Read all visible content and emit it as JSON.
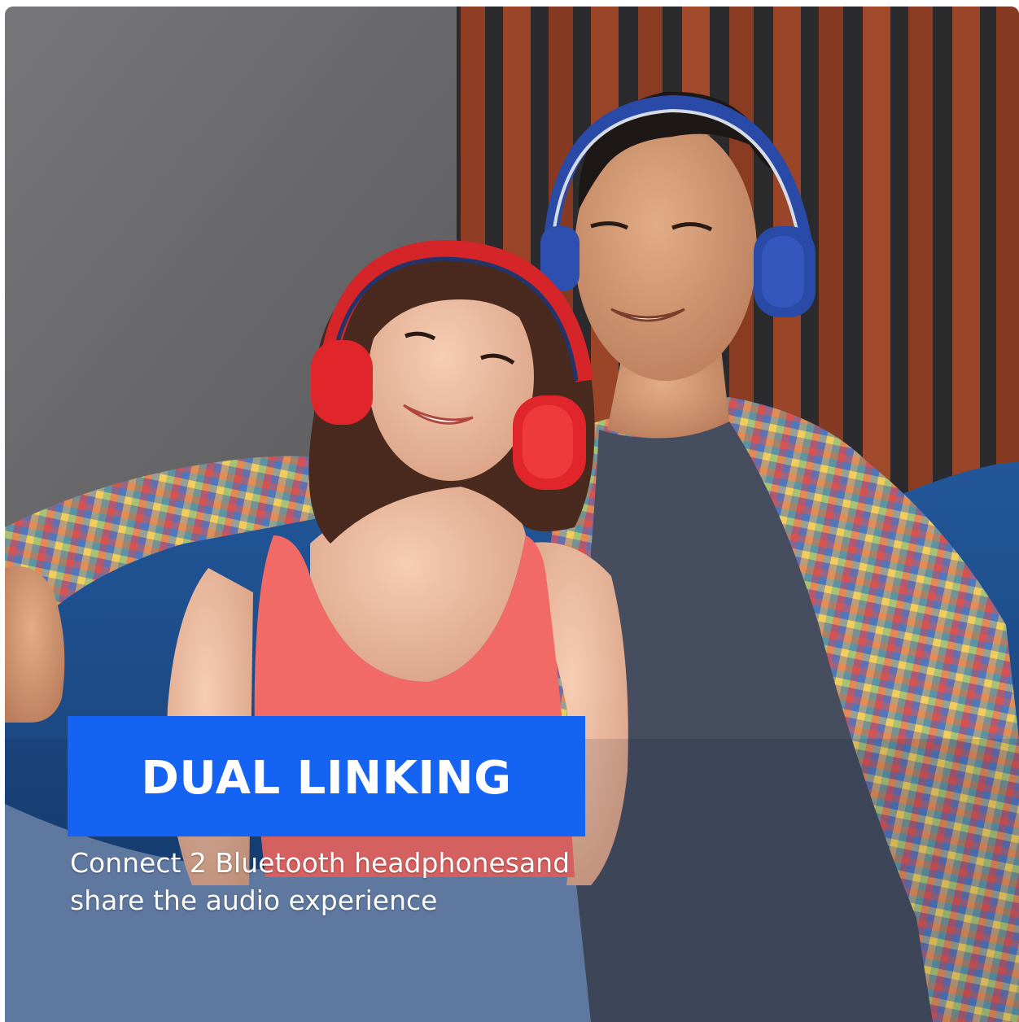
{
  "banner": {
    "title": "DUAL LINKING"
  },
  "caption": {
    "line1": "Connect 2 Bluetooth headphonesand",
    "line2": "share the audio experience"
  },
  "colors": {
    "banner": "#1463f2",
    "text": "#ffffff",
    "wall": "#6f6f71",
    "wood": "#8a3a22",
    "sofa": "#1f4f8e",
    "red_headphones": "#e0262a",
    "blue_headphones": "#2a4aa8",
    "tank_top": "#f26a66",
    "tshirt": "#454d5e",
    "jeans": "#6b86ad"
  },
  "photo": {
    "subject": "woman-with-red-headphones",
    "second_subject": "man-with-blue-headphones"
  }
}
